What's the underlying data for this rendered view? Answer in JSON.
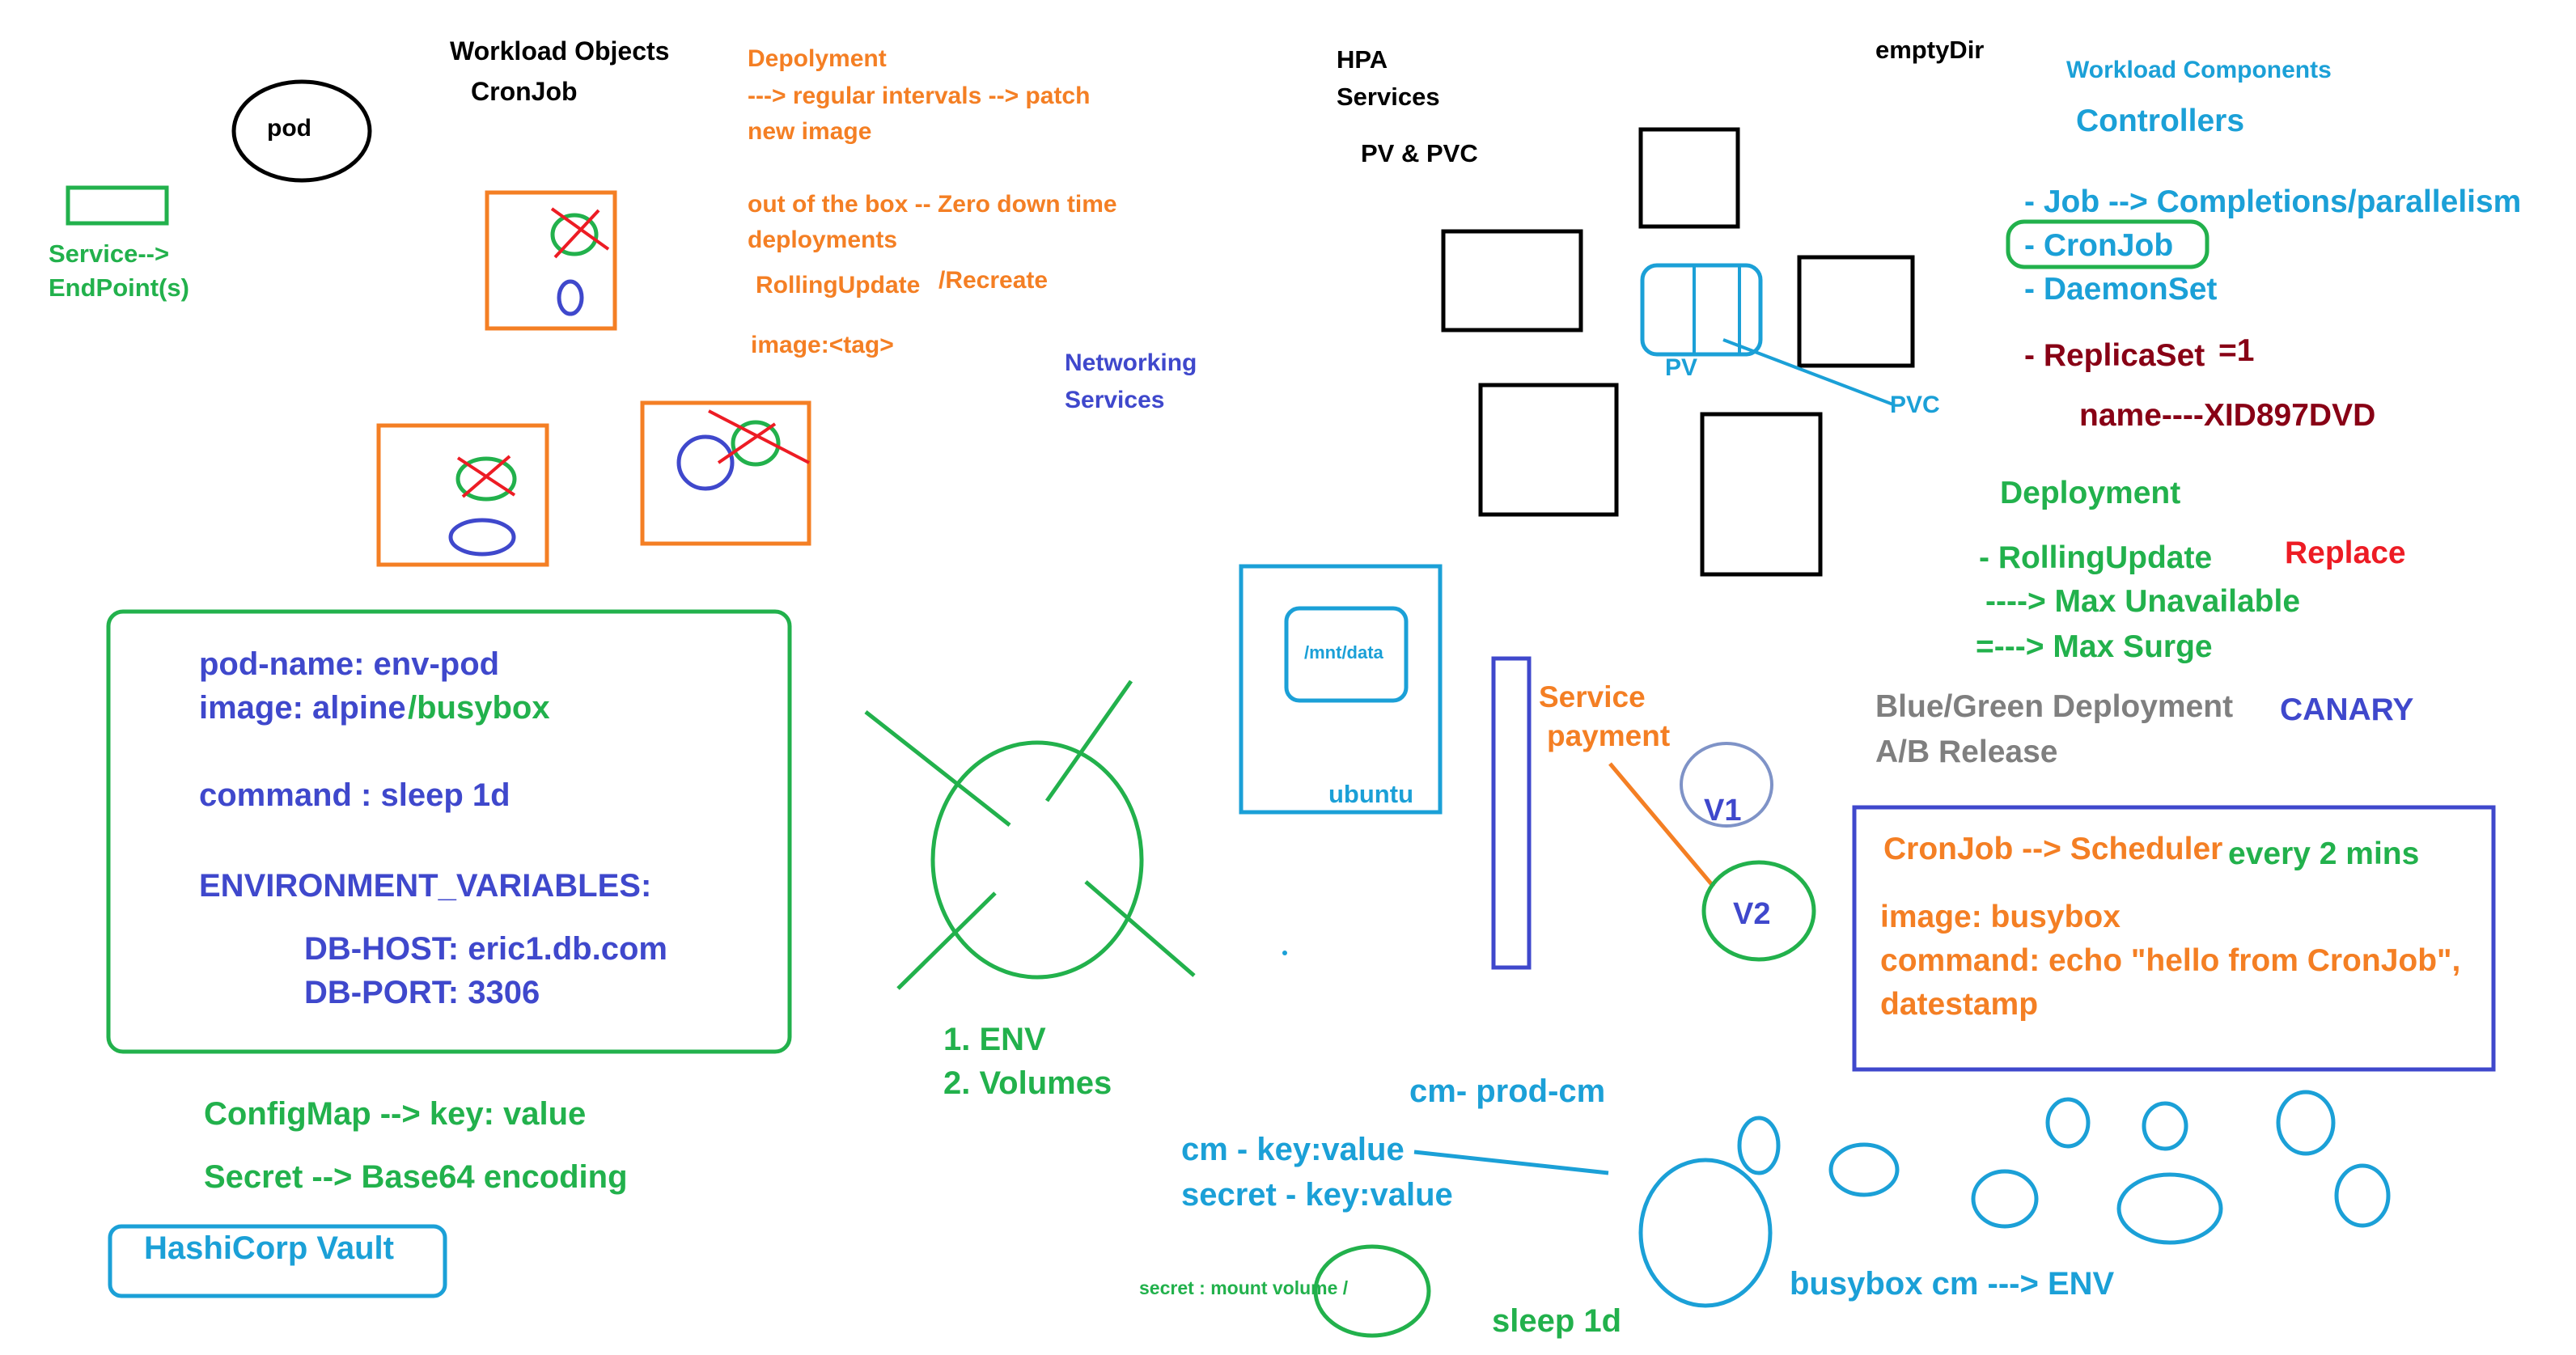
{
  "colors": {
    "black": "#000000",
    "green": "#22b14c",
    "orange": "#f47f24",
    "blue": "#3f48cc",
    "cyan": "#1ba0d7",
    "red": "#ed1c24",
    "darkred": "#880015",
    "gray": "#7f7f7f"
  },
  "header": {
    "workload_objects": "Workload Objects",
    "cronjob": "CronJob",
    "hpa": "HPA",
    "services": "Services",
    "pv_pvc": "PV & PVC",
    "emptydir": "emptyDir"
  },
  "left": {
    "pod": "pod",
    "service_line1": "Service-->",
    "service_line2": "EndPoint(s)"
  },
  "deployment_notes": {
    "line1": "Depolyment",
    "line2": "---> regular intervals --> patch",
    "line3": "new image",
    "line4": "out of the box -- Zero down time",
    "line5": "deployments",
    "rolling": "RollingUpdate",
    "recreate": "/Recreate",
    "image_tag": "image:<tag>"
  },
  "networking": {
    "line1": "Networking",
    "line2": "Services"
  },
  "storage": {
    "pv": "PV",
    "pvc": "PVC",
    "mnt": "/mnt/data",
    "ubuntu": "ubuntu"
  },
  "service_payment": {
    "line1": "Service",
    "line2": "payment",
    "v1": "V1",
    "v2": "V2"
  },
  "components": {
    "title": "Workload Components",
    "controllers": "Controllers",
    "job": "- Job --> Completions/parallelism",
    "cronjob": "- CronJob",
    "daemonset": "- DaemonSet",
    "replicaset": "- ReplicaSet",
    "replicaset_eq": "=1",
    "name": "name----XID897DVD",
    "deployment": "Deployment",
    "rolling": "- RollingUpdate",
    "replace": "Replace",
    "max_unavail": "----> Max Unavailable",
    "max_surge": "=---> Max Surge",
    "bluegreen": "Blue/Green Deployment",
    "ab": "A/B Release",
    "canary": "CANARY"
  },
  "env_pod": {
    "pod_name": "pod-name: env-pod",
    "image": "image: alpine",
    "busybox": "/busybox",
    "command": "command : sleep 1d",
    "env_title": "ENVIRONMENT_VARIABLES:",
    "db_host": "DB-HOST: eric1.db.com",
    "db_port": "DB-PORT: 3306"
  },
  "env_list": {
    "item1": "1. ENV",
    "item2": "2. Volumes"
  },
  "config": {
    "configmap": "ConfigMap --> key: value",
    "secret": "Secret --> Base64 encoding",
    "vault": "HashiCorp Vault"
  },
  "cronjob_box": {
    "title": "CronJob --> Scheduler",
    "every": "every 2 mins",
    "image": "image: busybox",
    "command1": "command: echo \"hello from CronJob\",",
    "command2": "datestamp"
  },
  "bottom": {
    "cm_prod": "cm- prod-cm",
    "cm_kv": "cm - key:value",
    "secret_kv": "secret - key:value",
    "secret_mount": "secret : mount volume /",
    "sleep": "sleep 1d",
    "busybox_env": "busybox  cm ---> ENV"
  }
}
